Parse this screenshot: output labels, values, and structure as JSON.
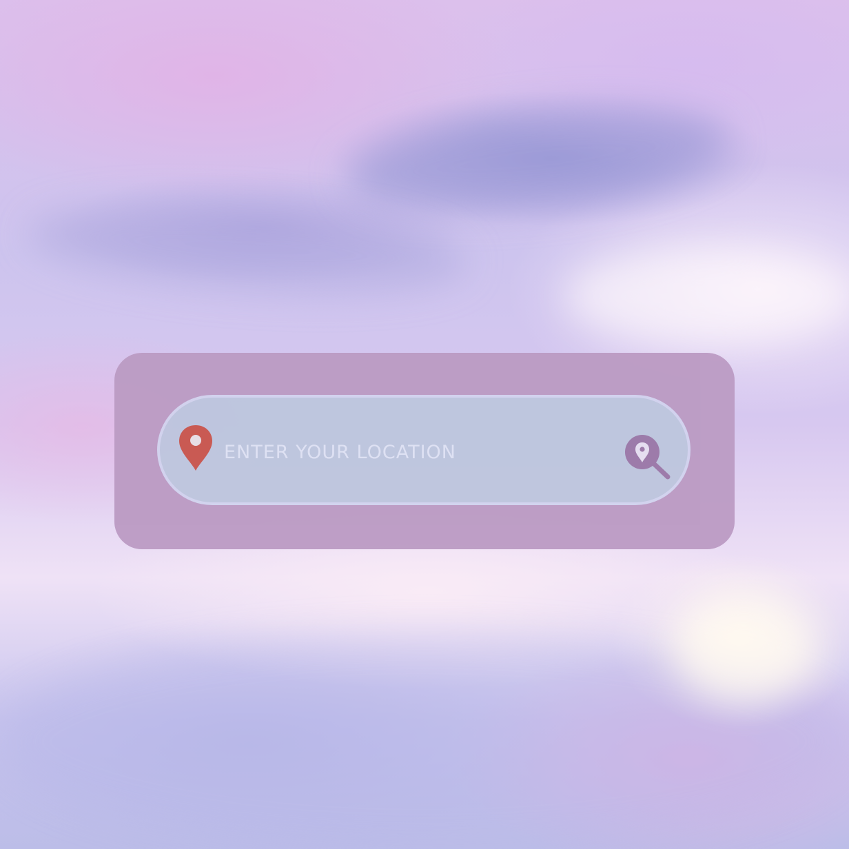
{
  "search": {
    "placeholder": "ENTER YOUR LOCATION",
    "location_icon": "map-pin-icon",
    "search_icon": "location-search-icon"
  },
  "colors": {
    "widget_background": "#bc9cc4",
    "field_background": "#bec6de",
    "field_border": "#d2d3ee",
    "placeholder_text": "#dfe2f4",
    "pin_red": "#c9574f",
    "search_icon_purple": "#9b79a8"
  }
}
